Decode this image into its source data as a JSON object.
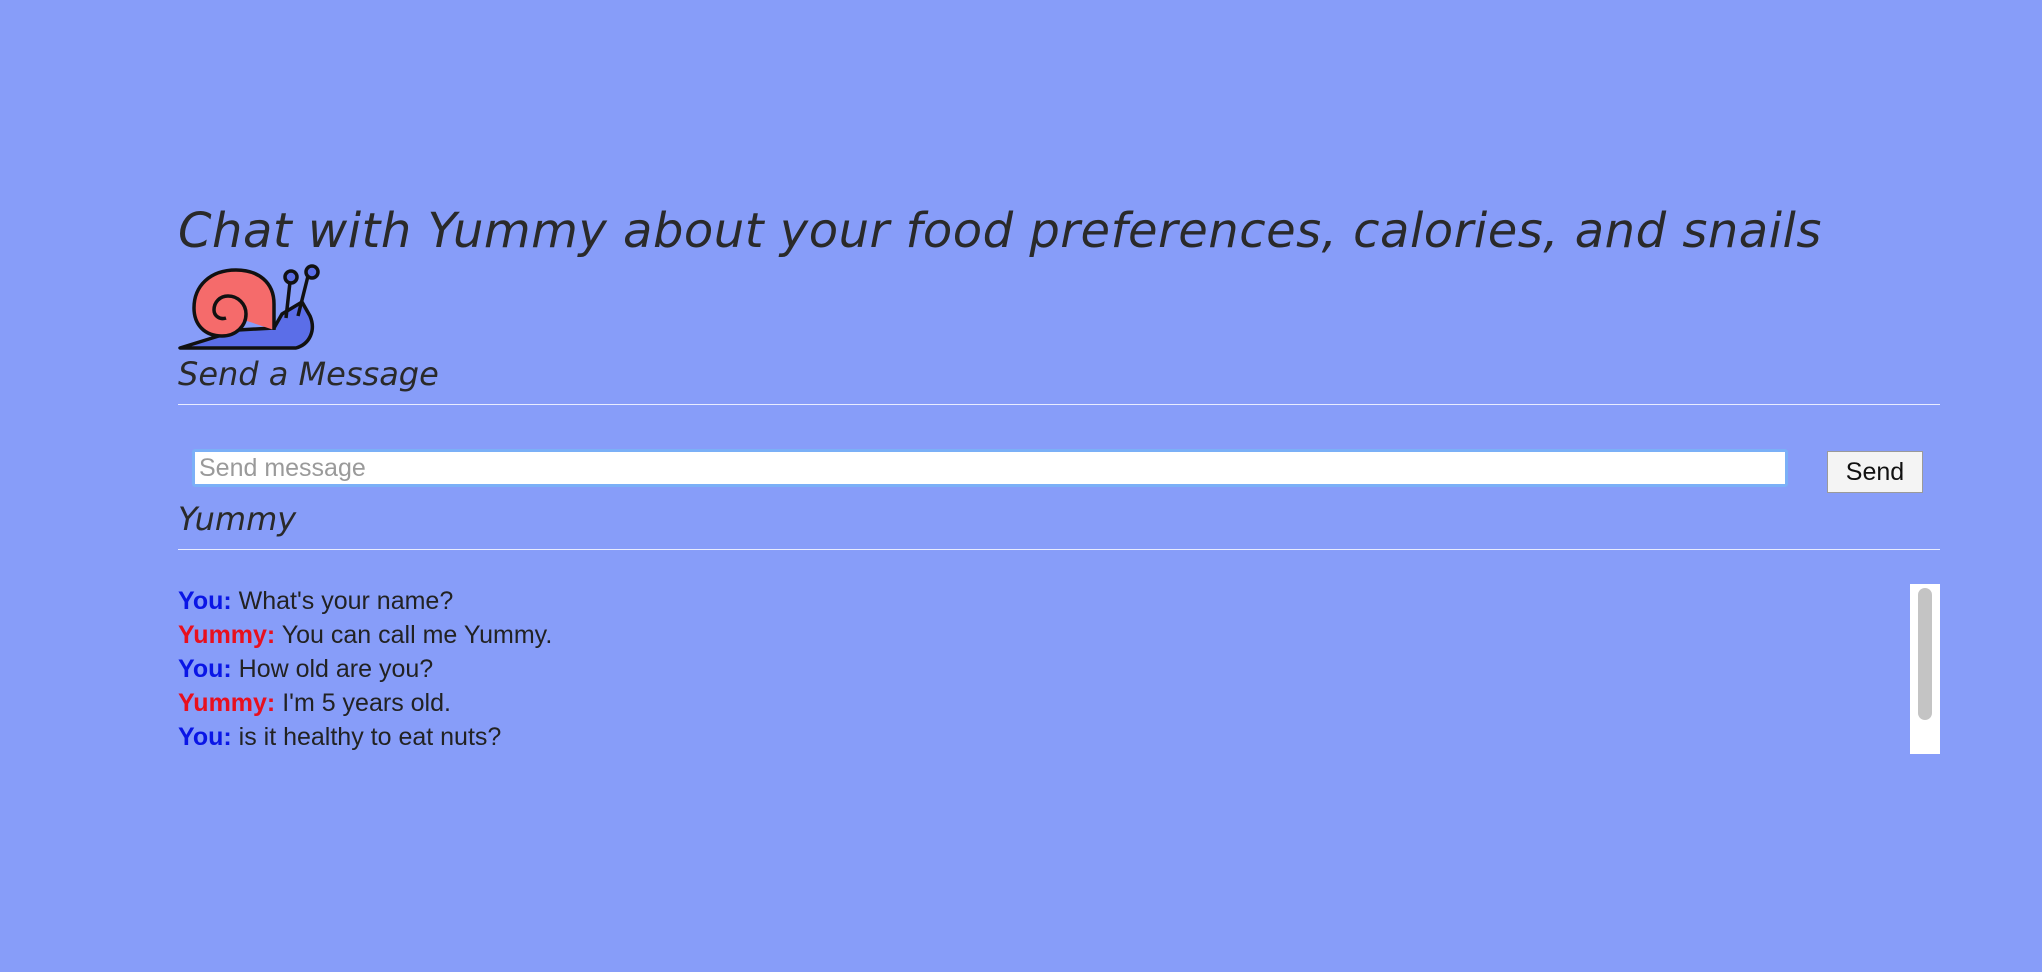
{
  "page": {
    "title": "Chat with Yummy about your food preferences, calories, and snails",
    "logo_icon": "snail-icon"
  },
  "compose": {
    "heading": "Send a Message",
    "input_placeholder": "Send message",
    "input_value": "",
    "send_label": "Send"
  },
  "conversation": {
    "heading": "Yummy",
    "messages": [
      {
        "speaker": "You:",
        "role": "user",
        "text": "What's your name?"
      },
      {
        "speaker": "Yummy:",
        "role": "bot",
        "text": "You can call me Yummy."
      },
      {
        "speaker": "You:",
        "role": "user",
        "text": "How old are you?"
      },
      {
        "speaker": "Yummy:",
        "role": "bot",
        "text": "I'm 5 years old."
      },
      {
        "speaker": "You:",
        "role": "user",
        "text": "is it healthy to eat nuts?"
      }
    ]
  },
  "colors": {
    "background": "#879df9",
    "user_label": "#0a16e6",
    "bot_label": "#e8101e",
    "snail_shell": "#f56b6b",
    "snail_body": "#5b6ee8"
  }
}
